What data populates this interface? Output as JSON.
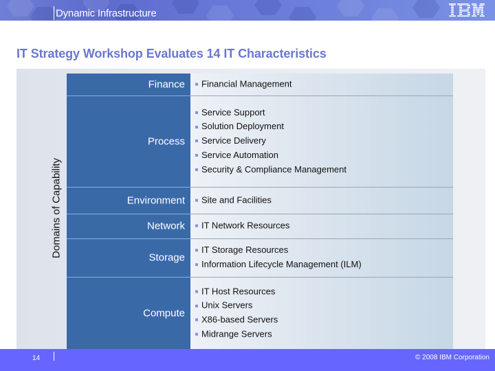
{
  "header": {
    "title": "Dynamic Infrastructure",
    "logo": "IBM"
  },
  "slide": {
    "title": "IT Strategy Workshop Evaluates 14 IT Characteristics",
    "axis_label": "Domains of Capability",
    "bullet_icon": "square-bullet-icon",
    "colors": {
      "domain_column": "#3a69a8",
      "title": "#6b77cc",
      "footer": "#6666ff",
      "bullet": "#7f97d6"
    },
    "domains": [
      {
        "label": "Finance",
        "items": [
          "Financial Management"
        ]
      },
      {
        "label": "Process",
        "items": [
          "Service Support",
          "Solution Deployment",
          "Service Delivery",
          "Service Automation",
          "Security & Compliance Management"
        ]
      },
      {
        "label": "Environment",
        "items": [
          "Site and Facilities"
        ]
      },
      {
        "label": "Network",
        "items": [
          "IT Network Resources"
        ]
      },
      {
        "label": "Storage",
        "items": [
          "IT Storage Resources",
          "Information Lifecycle Management (ILM)"
        ]
      },
      {
        "label": "Compute",
        "items": [
          "IT Host Resources",
          "Unix Servers",
          "X86-based Servers",
          "Midrange Servers"
        ]
      }
    ]
  },
  "footer": {
    "page_number": "14",
    "copyright": "© 2008 IBM Corporation"
  }
}
